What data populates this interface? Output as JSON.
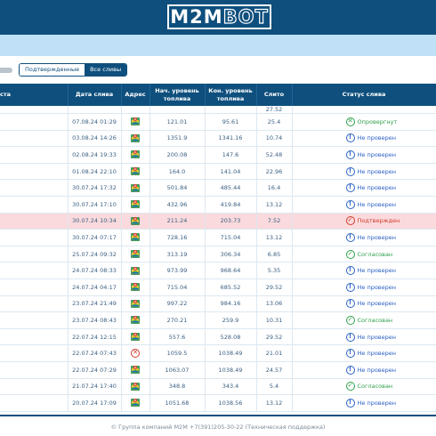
{
  "brand": {
    "logo_part1": "M2M",
    "logo_part2": "BOT"
  },
  "filters": {
    "confirmed_label": "Подтвержденные",
    "all_label": "Все сливы",
    "active": "all"
  },
  "table": {
    "headers": {
      "first": "ста",
      "date": "Дата слива",
      "address": "Адрес",
      "start_level": "Нач. уровень топлива",
      "end_level": "Кон. уровень топлива",
      "drain": "Слито",
      "status": "Статус слива"
    },
    "top_partial": {
      "date": "",
      "start": "",
      "end": "",
      "drain": "27.52"
    },
    "rows": [
      {
        "date": "07.08.24 01:29",
        "start": "121.01",
        "end": "95.61",
        "drain": "25.4",
        "status": "Опровергнут",
        "status_type": "rejected",
        "addr": "map"
      },
      {
        "date": "03.08.24 14:26",
        "start": "1351.9",
        "end": "1341.16",
        "drain": "10.74",
        "status": "Не проверен",
        "status_type": "unchecked",
        "addr": "map"
      },
      {
        "date": "02.08.24 19:33",
        "start": "200.08",
        "end": "147.6",
        "drain": "52.48",
        "status": "Не проверен",
        "status_type": "unchecked",
        "addr": "map"
      },
      {
        "date": "01.08.24 22:10",
        "start": "164.0",
        "end": "141.04",
        "drain": "22.96",
        "status": "Не проверен",
        "status_type": "unchecked",
        "addr": "map"
      },
      {
        "date": "30.07.24 17:32",
        "start": "501.84",
        "end": "485.44",
        "drain": "16.4",
        "status": "Не проверен",
        "status_type": "unchecked",
        "addr": "map"
      },
      {
        "date": "30.07.24 17:10",
        "start": "432.96",
        "end": "419.84",
        "drain": "13.12",
        "status": "Не проверен",
        "status_type": "unchecked",
        "addr": "map"
      },
      {
        "date": "30.07.24 10:34",
        "start": "211.24",
        "end": "203.73",
        "drain": "7.52",
        "status": "Подтвержден",
        "status_type": "confirmed",
        "addr": "map",
        "highlight": true
      },
      {
        "date": "30.07.24 07:17",
        "start": "728.16",
        "end": "715.04",
        "drain": "13.12",
        "status": "Не проверен",
        "status_type": "unchecked",
        "addr": "map"
      },
      {
        "date": "25.07.24 09:32",
        "start": "313.19",
        "end": "306.34",
        "drain": "6.85",
        "status": "Согласован",
        "status_type": "agreed",
        "addr": "map"
      },
      {
        "date": "24.07.24 08:33",
        "start": "973.99",
        "end": "968.64",
        "drain": "5.35",
        "status": "Не проверен",
        "status_type": "unchecked",
        "addr": "map"
      },
      {
        "date": "24.07.24 04:17",
        "start": "715.04",
        "end": "685.52",
        "drain": "29.52",
        "status": "Не проверен",
        "status_type": "unchecked",
        "addr": "map"
      },
      {
        "date": "23.07.24 21:49",
        "start": "997.22",
        "end": "984.16",
        "drain": "13.06",
        "status": "Не проверен",
        "status_type": "unchecked",
        "addr": "map"
      },
      {
        "date": "23.07.24 08:43",
        "start": "270.21",
        "end": "259.9",
        "drain": "10.31",
        "status": "Согласован",
        "status_type": "agreed",
        "addr": "map"
      },
      {
        "date": "22.07.24 12:15",
        "start": "557.6",
        "end": "528.08",
        "drain": "29.52",
        "status": "Не проверен",
        "status_type": "unchecked",
        "addr": "map"
      },
      {
        "date": "22.07.24 07:43",
        "start": "1059.5",
        "end": "1038.49",
        "drain": "21.01",
        "status": "Не проверен",
        "status_type": "unchecked",
        "addr": "error"
      },
      {
        "date": "22.07.24 07:29",
        "start": "1063.07",
        "end": "1038.49",
        "drain": "24.57",
        "status": "Не проверен",
        "status_type": "unchecked",
        "addr": "map"
      },
      {
        "date": "21.07.24 17:40",
        "start": "348.8",
        "end": "343.4",
        "drain": "5.4",
        "status": "Согласован",
        "status_type": "agreed",
        "addr": "map"
      },
      {
        "date": "20.07.24 17:09",
        "start": "1051.68",
        "end": "1038.56",
        "drain": "13.12",
        "status": "Не проверен",
        "status_type": "unchecked",
        "addr": "map"
      }
    ]
  },
  "footer": {
    "text": "© Группа компаний M2M +7(391)205-30-22 (Техническая поддержка)"
  },
  "colors": {
    "primary": "#0e4f7d",
    "banner": "#bfe0f7",
    "highlight": "#fadadd",
    "unchecked": "#2b62c5",
    "agreed": "#2fa14c",
    "confirmed": "#d33a2c"
  }
}
